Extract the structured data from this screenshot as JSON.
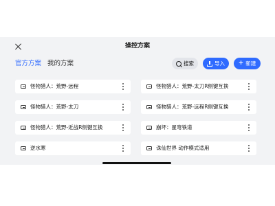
{
  "header": {
    "title": "操控方案"
  },
  "tabs": [
    {
      "label": "官方方案",
      "active": true
    },
    {
      "label": "我的方案",
      "active": false
    }
  ],
  "actions": {
    "search_label": "搜索",
    "import_label": "导入",
    "new_label": "新建"
  },
  "colors": {
    "accent": "#2f6bff",
    "panel_bg": "#f2f3f5"
  },
  "schemes": [
    {
      "label": "怪物猎人：荒野-远程"
    },
    {
      "label": "怪物猎人：荒野-太刀R侧键互换"
    },
    {
      "label": "怪物猎人：荒野-太刀"
    },
    {
      "label": "怪物猎人：荒野-远程R侧键互换"
    },
    {
      "label": "怪物猎人：荒野-近战R侧键互换"
    },
    {
      "label": "崩坏：星穹铁道"
    },
    {
      "label": "逆水寒"
    },
    {
      "label": "诛仙世界 动作模式适用"
    }
  ]
}
